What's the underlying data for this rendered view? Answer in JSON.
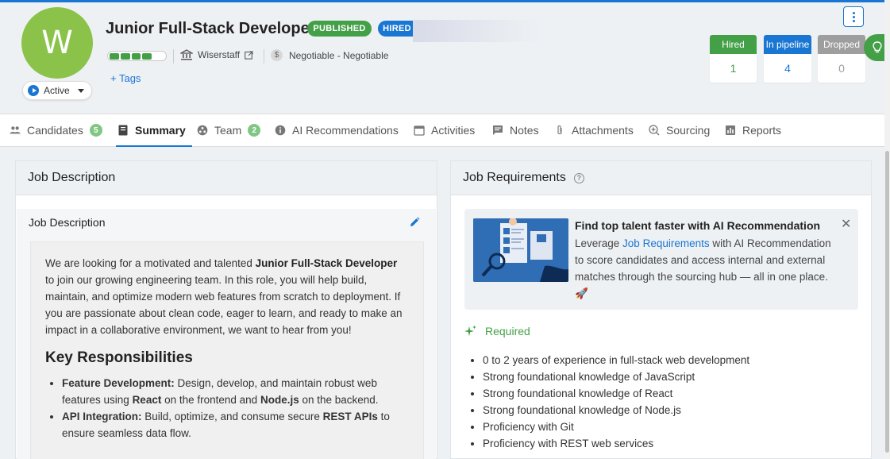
{
  "header": {
    "avatar_letter": "W",
    "job_title": "Junior Full-Stack Developer",
    "badge_published": "PUBLISHED",
    "badge_hired": "HIRED",
    "status": "Active",
    "company": "Wiserstaff",
    "salary": "Negotiable - Negotiable",
    "tags_label": "+ Tags",
    "progress_filled_segments": 4,
    "progress_total_segments": 5
  },
  "stats": {
    "hired_label": "Hired",
    "hired_value": "1",
    "pipeline_label": "In pipeline",
    "pipeline_value": "4",
    "dropped_label": "Dropped",
    "dropped_value": "0"
  },
  "tabs": [
    {
      "label": "Candidates",
      "count": "5",
      "icon": "people-icon"
    },
    {
      "label": "Summary",
      "icon": "document-icon",
      "active": true
    },
    {
      "label": "Team",
      "count": "2",
      "icon": "team-icon"
    },
    {
      "label": "AI Recommendations",
      "icon": "info-icon"
    },
    {
      "label": "Activities",
      "icon": "calendar-icon"
    },
    {
      "label": "Notes",
      "icon": "note-icon"
    },
    {
      "label": "Attachments",
      "icon": "paperclip-icon"
    },
    {
      "label": "Sourcing",
      "icon": "sourcing-icon"
    },
    {
      "label": "Reports",
      "icon": "chart-icon"
    }
  ],
  "job_description": {
    "panel_title": "Job Description",
    "card_title": "Job Description",
    "intro_1": "We are looking for a motivated and talented ",
    "intro_bold": "Junior Full-Stack Developer",
    "intro_2": " to join our growing engineering team. In this role, you will help build, maintain, and optimize modern web features from scratch to deployment. If you are passionate about clean code, eager to learn, and ready to make an impact in a collaborative environment, we want to hear from you!",
    "responsibilities_heading": "Key Responsibilities",
    "resp_1_title": "Feature Development:",
    "resp_1_a": " Design, develop, and maintain robust web features using ",
    "resp_1_b": "React",
    "resp_1_c": " on the frontend and ",
    "resp_1_d": "Node.js",
    "resp_1_e": " on the backend.",
    "resp_2_title": "API Integration:",
    "resp_2_a": " Build, optimize, and consume secure ",
    "resp_2_b": "REST APIs",
    "resp_2_c": " to ensure seamless data flow."
  },
  "job_requirements": {
    "panel_title": "Job Requirements",
    "promo_title": "Find top talent faster with AI Recommendation",
    "promo_text_1": "Leverage ",
    "promo_link": "Job Requirements",
    "promo_text_2": " with AI Recommendation to score candidates and access internal and external matches through the sourcing hub — all in one place. 🚀",
    "required_label": "Required",
    "requirements": [
      "0 to 2 years of experience in full-stack web development",
      "Strong foundational knowledge of JavaScript",
      "Strong foundational knowledge of React",
      "Strong foundational knowledge of Node.js",
      "Proficiency with Git",
      "Proficiency with REST web services"
    ]
  },
  "colors": {
    "primary": "#1976d2",
    "success": "#43a047",
    "muted": "#9e9e9e",
    "avatar": "#8bc34a"
  }
}
